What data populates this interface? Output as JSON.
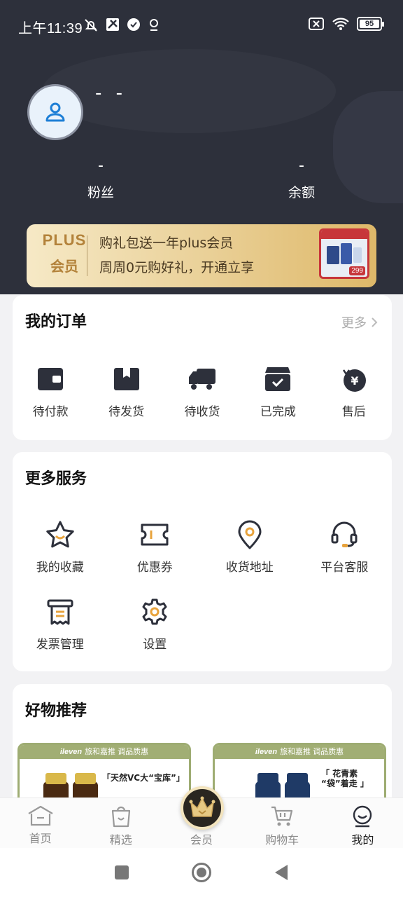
{
  "status_bar": {
    "time": "上午11:39",
    "battery": "95"
  },
  "profile": {
    "username": "- -"
  },
  "stats": [
    {
      "value": "-",
      "label": "粉丝"
    },
    {
      "value": "-",
      "label": "余额"
    }
  ],
  "plus_banner": {
    "logo_top": "PLUS",
    "logo_bottom": "会员",
    "line1": "购礼包送一年plus会员",
    "line2": "周周0元购好礼，开通立享",
    "gift_price": "299"
  },
  "orders": {
    "title": "我的订单",
    "more": "更多",
    "items": [
      {
        "label": "待付款",
        "icon": "wallet-icon"
      },
      {
        "label": "待发货",
        "icon": "package-icon"
      },
      {
        "label": "待收货",
        "icon": "truck-icon"
      },
      {
        "label": "已完成",
        "icon": "box-check-icon"
      },
      {
        "label": "售后",
        "icon": "refund-icon"
      }
    ]
  },
  "services": {
    "title": "更多服务",
    "items": [
      {
        "label": "我的收藏",
        "icon": "star-icon"
      },
      {
        "label": "优惠券",
        "icon": "coupon-icon"
      },
      {
        "label": "收货地址",
        "icon": "location-icon"
      },
      {
        "label": "平台客服",
        "icon": "headset-icon"
      },
      {
        "label": "发票管理",
        "icon": "invoice-icon"
      },
      {
        "label": "设置",
        "icon": "gear-icon"
      }
    ]
  },
  "recommend": {
    "title": "好物推荐",
    "products": [
      {
        "brand": "ileven",
        "brand_sub": "旅和嘉推 调品质惠",
        "tag": "「天然VC大“宝库”」"
      },
      {
        "brand": "ileven",
        "brand_sub": "旅和嘉推 调品质惠",
        "tag": "「 花青素 “袋”着走 」"
      }
    ]
  },
  "tabbar": [
    {
      "label": "首页",
      "icon": "home-icon"
    },
    {
      "label": "精选",
      "icon": "shopping-bag-icon"
    },
    {
      "label": "会员",
      "icon": "crown-icon"
    },
    {
      "label": "购物车",
      "icon": "cart-icon"
    },
    {
      "label": "我的",
      "icon": "smile-icon",
      "active": true
    }
  ],
  "colors": {
    "header_bg": "#2d303b",
    "accent_gold": "#deb869",
    "page_bg": "#f2f2f4"
  }
}
